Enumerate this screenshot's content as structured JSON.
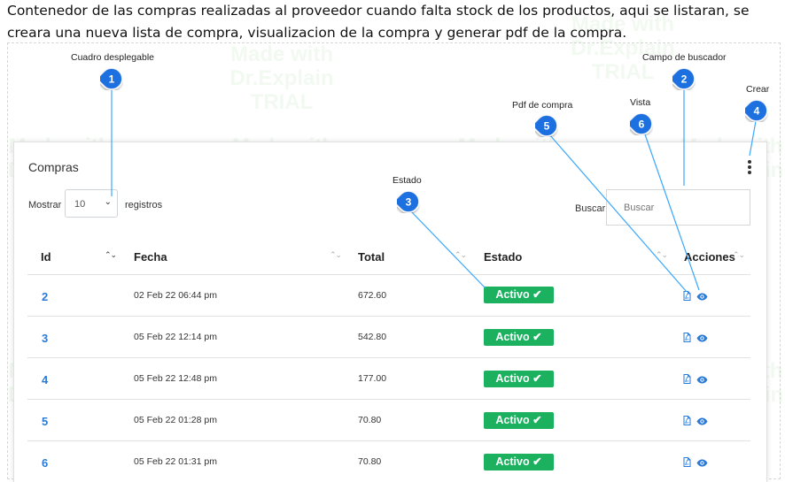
{
  "intro_text": "Contenedor de las compras realizadas al proveedor cuando falta stock de los productos, aqui se listaran, se creara una nueva lista de compra, visualizacion de la compra y generar pdf de la compra.",
  "watermark": "Made with\nDr.Explain\nTRIAL",
  "card": {
    "title": "Compras",
    "show_label": "Mostrar",
    "page_size": "10",
    "records_label": "registros",
    "search_label": "Buscar",
    "search_placeholder": "Buscar"
  },
  "columns": [
    "Id",
    "Fecha",
    "Total",
    "Estado",
    "Acciones"
  ],
  "rows": [
    {
      "id": "2",
      "fecha": "02 Feb 22 06:44 pm",
      "total": "672.60",
      "estado": "Activo"
    },
    {
      "id": "3",
      "fecha": "05 Feb 22 12:14 pm",
      "total": "542.80",
      "estado": "Activo"
    },
    {
      "id": "4",
      "fecha": "05 Feb 22 12:48 pm",
      "total": "177.00",
      "estado": "Activo"
    },
    {
      "id": "5",
      "fecha": "05 Feb 22 01:28 pm",
      "total": "70.80",
      "estado": "Activo"
    },
    {
      "id": "6",
      "fecha": "05 Feb 22 01:31 pm",
      "total": "70.80",
      "estado": "Activo"
    }
  ],
  "callouts": [
    {
      "num": "1",
      "label": "Cuadro desplegable"
    },
    {
      "num": "2",
      "label": "Campo de buscador"
    },
    {
      "num": "3",
      "label": "Estado"
    },
    {
      "num": "4",
      "label": "Crear"
    },
    {
      "num": "5",
      "label": "Pdf de compra"
    },
    {
      "num": "6",
      "label": "Vista"
    }
  ],
  "colors": {
    "link": "#2a7ad6",
    "badge": "#1bb15f",
    "pin": "#1a6fe0"
  },
  "icons": [
    "pdf-icon",
    "eye-icon",
    "check-icon",
    "chevron-down-icon",
    "kebab-menu-icon",
    "sort-icon"
  ]
}
